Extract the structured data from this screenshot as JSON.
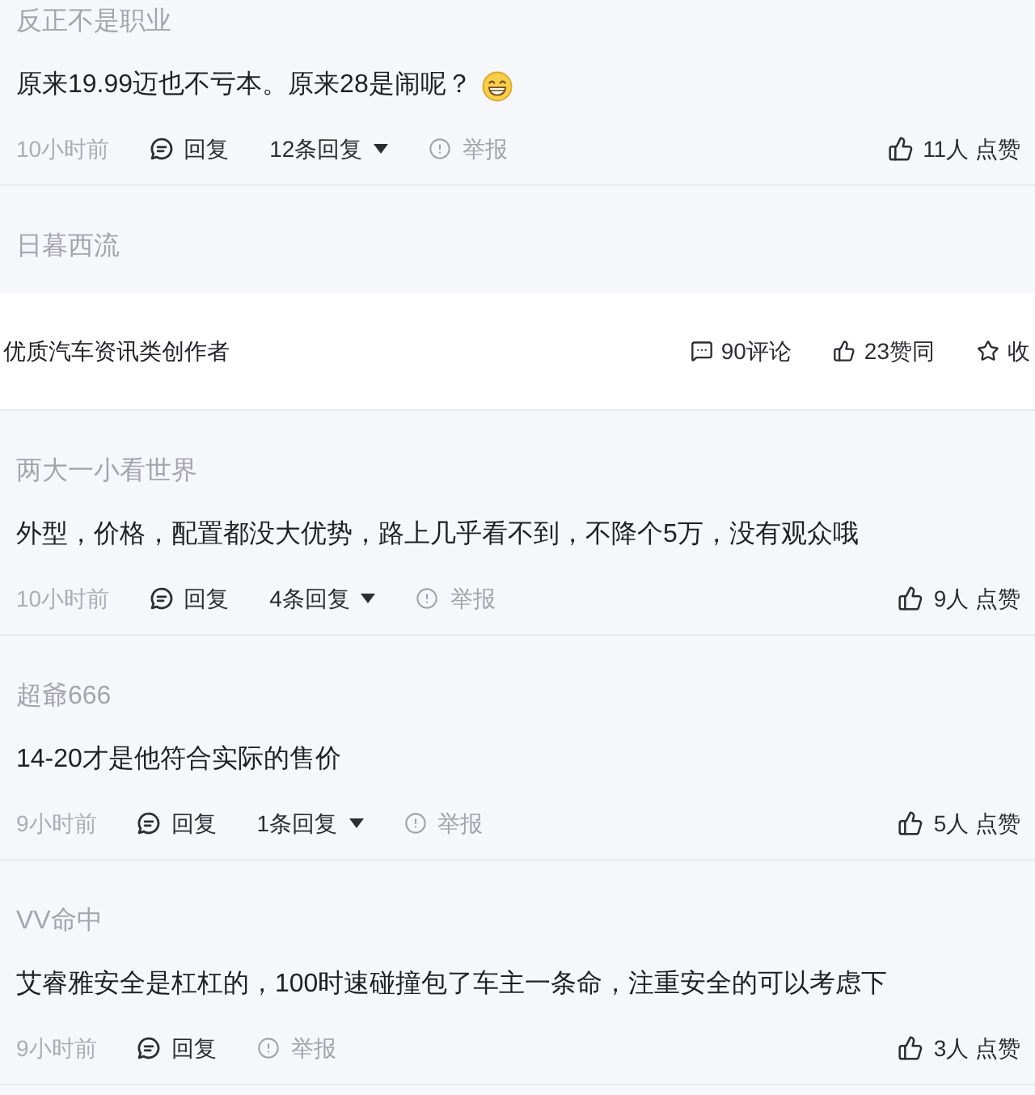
{
  "feed": [
    {
      "kind": "comment",
      "username": "反正不是职业",
      "text": "原来19.99迈也不亏本。原来28是闹呢？",
      "emoji": true,
      "time": "10小时前",
      "reply": "回复",
      "replies": "12条回复",
      "report": "举报",
      "likes": "11人 点赞"
    },
    {
      "kind": "comment",
      "username": "日暮西流"
    },
    {
      "kind": "author_bar",
      "title": "优质汽车资讯类创作者",
      "comments": "90评论",
      "agrees": "23赞同",
      "favorite": "收"
    },
    {
      "kind": "comment",
      "username": "两大一小看世界",
      "text": "外型，价格，配置都没大优势，路上几乎看不到，不降个5万，没有观众哦",
      "emoji": false,
      "time": "10小时前",
      "reply": "回复",
      "replies": "4条回复",
      "report": "举报",
      "likes": "9人 点赞"
    },
    {
      "kind": "comment",
      "username": "超爺666",
      "text": "14-20才是他符合实际的售价",
      "emoji": false,
      "time": "9小时前",
      "reply": "回复",
      "replies": "1条回复",
      "report": "举报",
      "likes": "5人 点赞"
    },
    {
      "kind": "comment",
      "username": "VV命中",
      "text": "艾睿雅安全是杠杠的，100时速碰撞包了车主一条命，注重安全的可以考虑下",
      "emoji": false,
      "time": "9小时前",
      "reply": "回复",
      "report": "举报",
      "likes": "3人 点赞"
    }
  ]
}
